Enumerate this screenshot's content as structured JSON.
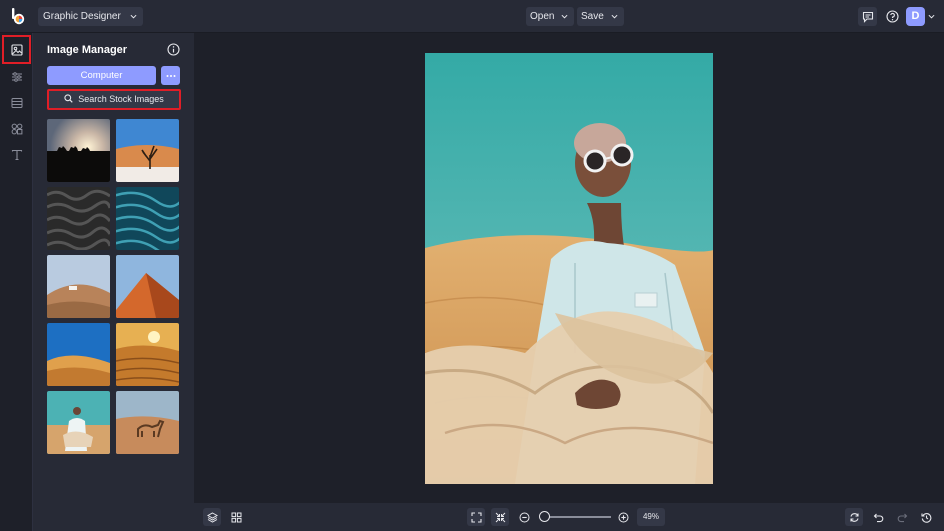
{
  "header": {
    "mode_label": "Graphic Designer",
    "open_label": "Open",
    "save_label": "Save",
    "avatar_initial": "D"
  },
  "rail": {
    "items": [
      "image-manager",
      "adjustments",
      "layouts",
      "graphics",
      "text"
    ]
  },
  "panel": {
    "title": "Image Manager",
    "computer_label": "Computer",
    "stock_label": "Search Stock Images"
  },
  "zoom": {
    "value": "49%"
  },
  "colors": {
    "accent": "#8e9bff",
    "highlight": "#e01e27",
    "panel_bg": "#272a36",
    "workspace_bg": "#1e2029"
  }
}
